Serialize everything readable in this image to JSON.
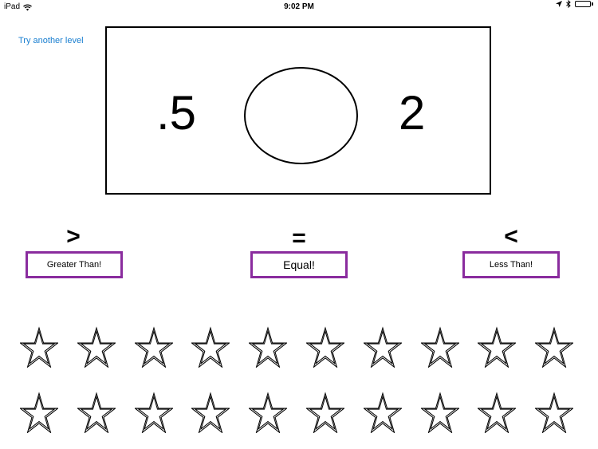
{
  "status": {
    "device": "iPad",
    "time": "9:02 PM"
  },
  "nav": {
    "back_label": "Try another level"
  },
  "problem": {
    "left": ".5",
    "right": "2"
  },
  "choices": {
    "greater": {
      "symbol": ">",
      "label": "Greater Than!"
    },
    "equal": {
      "symbol": "=",
      "label": "Equal!"
    },
    "less": {
      "symbol": "<",
      "label": "Less Than!"
    }
  },
  "stars": {
    "rows": 2,
    "per_row": 10,
    "earned": 0,
    "icon": "star-outline-icon"
  },
  "colors": {
    "link": "#1a7fd0",
    "button_border": "#8a2c9e"
  }
}
